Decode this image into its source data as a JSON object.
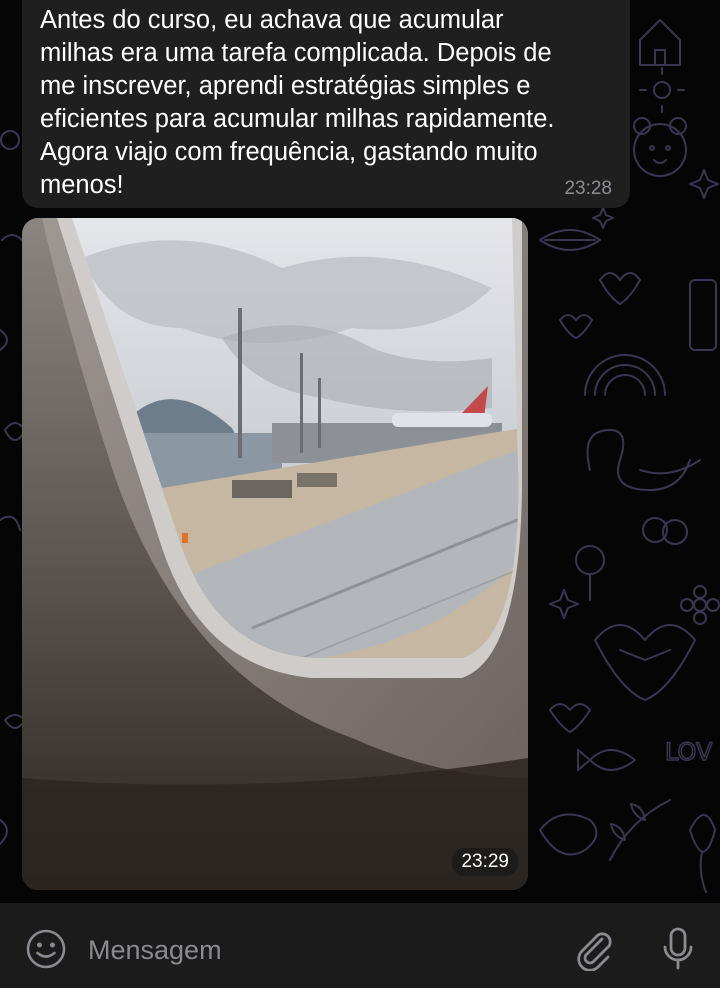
{
  "messages": [
    {
      "type": "text",
      "text": "Antes do curso, eu achava que acumular\nmilhas era uma tarefa complicada. Depois de\nme inscrever, aprendi estratégias simples e\neficientes para acumular milhas rapidamente.\nAgora viajo com frequência, gastando muito\nmenos!",
      "time": "23:28"
    },
    {
      "type": "photo",
      "time": "23:29"
    }
  ],
  "composer": {
    "placeholder": "Mensagem",
    "value": "",
    "emoji_icon": "smiley-icon",
    "attach_icon": "paperclip-icon",
    "mic_icon": "microphone-icon"
  },
  "colors": {
    "background": "#050506",
    "bubble": "#1f1f20",
    "input_bar": "#1b1b1c",
    "text": "#ffffff",
    "timestamp": "#8d8d92",
    "wallpaper_doodle": "#3a3550"
  }
}
